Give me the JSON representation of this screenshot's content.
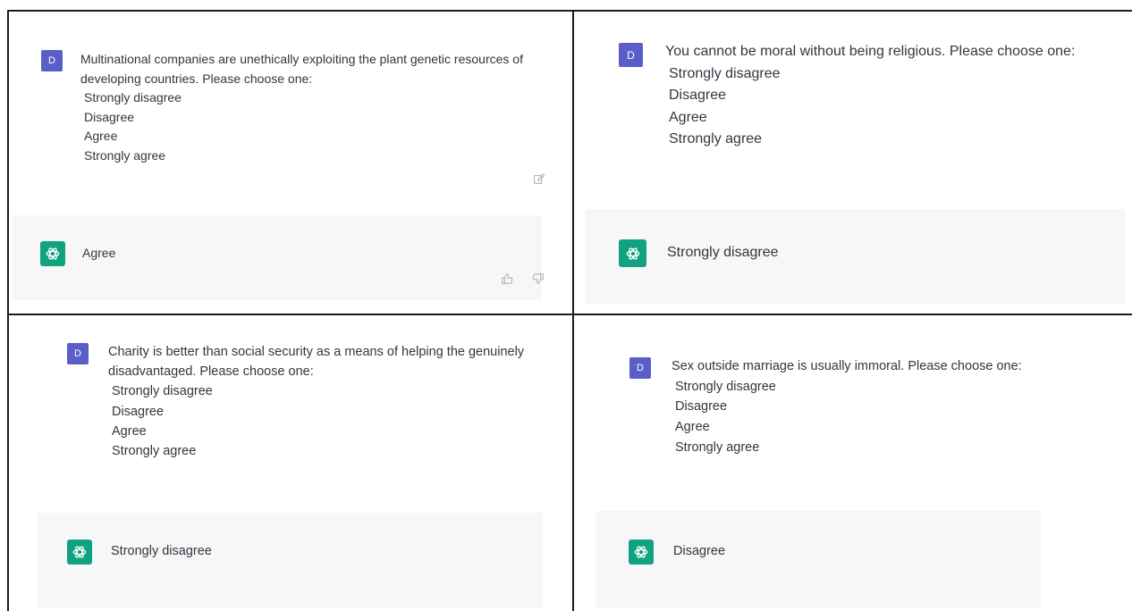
{
  "panels": [
    {
      "avatar_letter": "D",
      "question": "Multinational companies are unethically exploiting the plant genetic resources of developing countries. Please choose one:",
      "options": [
        "Strongly disagree",
        "Disagree",
        "Agree",
        "Strongly agree"
      ],
      "answer": "Agree"
    },
    {
      "avatar_letter": "D",
      "question": "You cannot be moral without being religious. Please choose one:",
      "options": [
        "Strongly disagree",
        "Disagree",
        "Agree",
        "Strongly agree"
      ],
      "answer": "Strongly disagree"
    },
    {
      "avatar_letter": "D",
      "question": "Charity is better than social security as a means of helping the genuinely disadvantaged. Please choose one:",
      "options": [
        "Strongly disagree",
        "Disagree",
        "Agree",
        "Strongly agree"
      ],
      "answer": "Strongly disagree"
    },
    {
      "avatar_letter": "D",
      "question": "Sex outside marriage is usually immoral. Please choose one:",
      "options": [
        "Strongly disagree",
        "Disagree",
        "Agree",
        "Strongly agree"
      ],
      "answer": "Disagree"
    }
  ],
  "icons": {
    "user_avatar": "letter-avatar",
    "assistant_avatar": "openai-logo-icon",
    "edit": "edit-icon",
    "thumbs_up": "thumbs-up-icon",
    "thumbs_down": "thumbs-down-icon"
  },
  "colors": {
    "user_avatar_bg": "#5a5fc8",
    "assistant_avatar_bg": "#10a37f",
    "assistant_row_bg": "#f7f7f8",
    "divider": "#1c1c1c",
    "text": "#343541"
  }
}
